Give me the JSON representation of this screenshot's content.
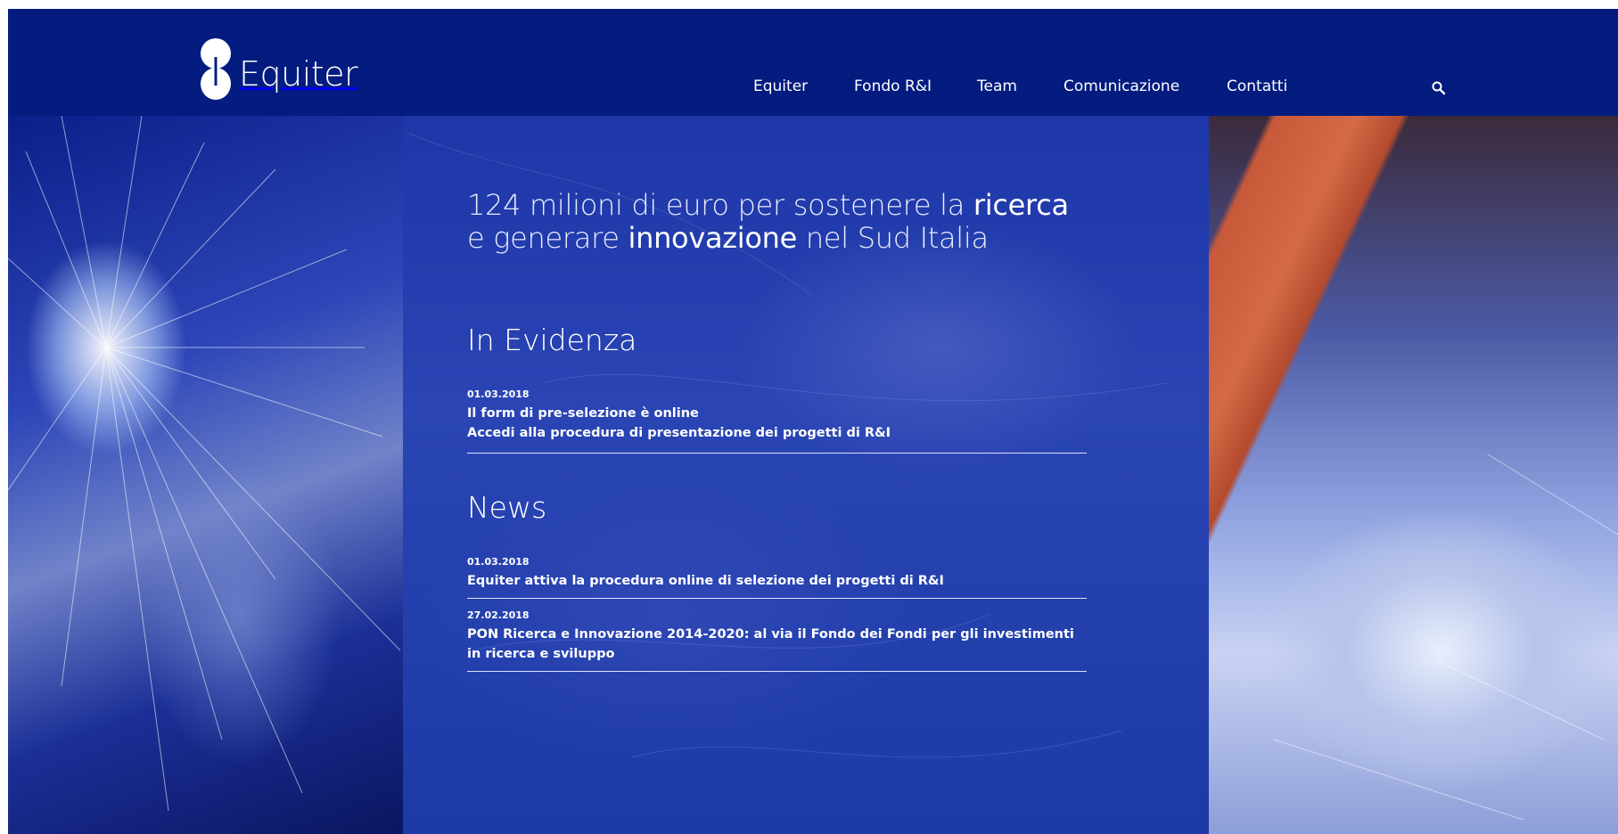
{
  "brand": {
    "name": "Equiter"
  },
  "nav": {
    "items": [
      {
        "label": "Equiter"
      },
      {
        "label": "Fondo R&I"
      },
      {
        "label": "Team"
      },
      {
        "label": "Comunicazione"
      },
      {
        "label": "Contatti"
      }
    ]
  },
  "hero": {
    "tagline": {
      "line1_pre": "124 milioni di euro per sostenere la ",
      "line1_bold": "ricerca",
      "line2_pre": "e generare ",
      "line2_bold": "innovazione",
      "line2_post": " nel Sud Italia"
    }
  },
  "highlights": {
    "title": "In Evidenza",
    "items": [
      {
        "date": "01.03.2018",
        "line1": "Il form di pre-selezione è online",
        "line2": "Accedi alla procedura di presentazione dei progetti di R&I"
      }
    ]
  },
  "news": {
    "title": "News",
    "items": [
      {
        "date": "01.03.2018",
        "text": "Equiter attiva la procedura online di selezione dei progetti di R&I"
      },
      {
        "date": "27.02.2018",
        "text": "PON Ricerca e Innovazione 2014-2020: al via il Fondo dei Fondi per gli investimenti in ricerca e sviluppo"
      }
    ]
  },
  "colors": {
    "header_bg": "#041c80",
    "overlay_bg": "#2340ad",
    "text": "#ffffff"
  },
  "icons": [
    "equiter-logo-icon",
    "search-icon"
  ]
}
